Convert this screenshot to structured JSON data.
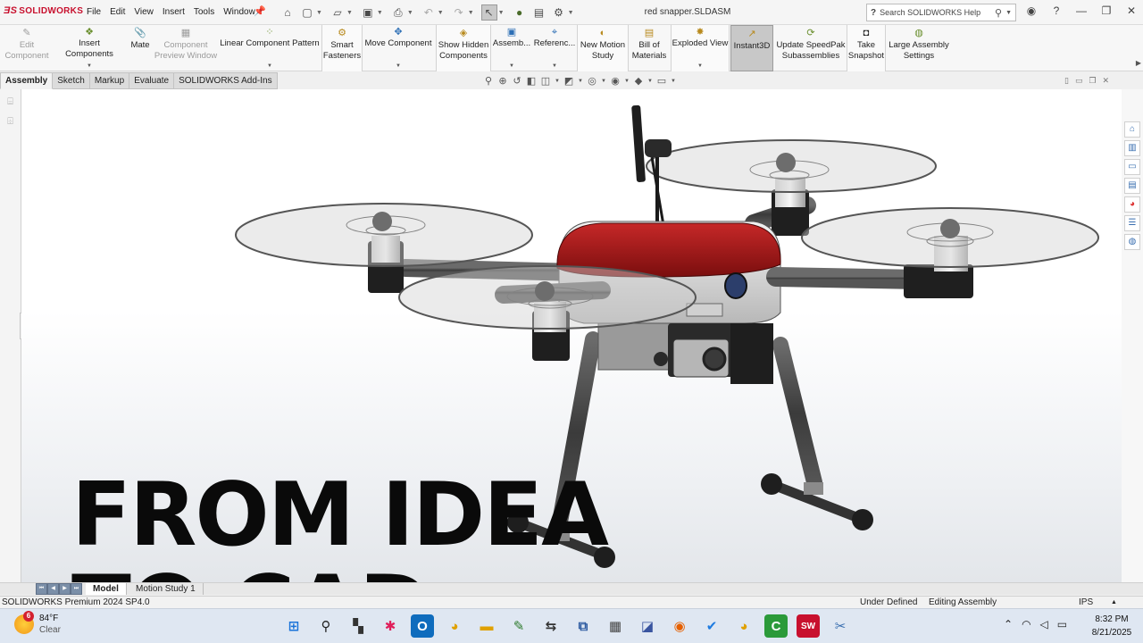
{
  "app": {
    "brand": "SOLIDWORKS",
    "document_title": "red snapper.SLDASM",
    "menus": [
      "File",
      "Edit",
      "View",
      "Insert",
      "Tools",
      "Window"
    ],
    "search_placeholder": "Search SOLIDWORKS Help"
  },
  "commands": [
    {
      "label": "Edit Component",
      "disabled": true,
      "icon": "edit-component-icon"
    },
    {
      "label": "Insert Components",
      "icon": "insert-components-icon"
    },
    {
      "label": "Mate",
      "icon": "mate-icon"
    },
    {
      "label": "Component Preview Window",
      "disabled": true,
      "icon": "preview-window-icon"
    },
    {
      "label": "Linear Component Pattern",
      "icon": "linear-pattern-icon"
    },
    {
      "label": "Smart Fasteners",
      "icon": "smart-fasteners-icon"
    },
    {
      "label": "Move Component",
      "icon": "move-component-icon"
    },
    {
      "label": "Show Hidden Components",
      "icon": "show-hidden-icon"
    },
    {
      "label": "Assemb...",
      "icon": "assembly-features-icon"
    },
    {
      "label": "Referenc...",
      "icon": "reference-geometry-icon"
    },
    {
      "label": "New Motion Study",
      "icon": "motion-study-icon"
    },
    {
      "label": "Bill of Materials",
      "icon": "bom-icon"
    },
    {
      "label": "Exploded View",
      "icon": "exploded-view-icon"
    },
    {
      "label": "Instant3D",
      "icon": "instant3d-icon"
    },
    {
      "label": "Update SpeedPak Subassemblies",
      "icon": "speedpak-icon"
    },
    {
      "label": "Take Snapshot",
      "icon": "snapshot-icon"
    },
    {
      "label": "Large Assembly Settings",
      "icon": "large-assembly-icon"
    }
  ],
  "tabs": [
    "Assembly",
    "Sketch",
    "Markup",
    "Evaluate",
    "SOLIDWORKS Add-Ins"
  ],
  "overlay": {
    "line1": "FROM IDEA",
    "line2": "TO CAD"
  },
  "bottom_tabs": [
    "Model",
    "Motion Study 1"
  ],
  "status": {
    "version": "SOLIDWORKS Premium 2024 SP4.0",
    "defined": "Under Defined",
    "mode": "Editing Assembly",
    "units": "IPS"
  },
  "taskbar": {
    "weather_badge": "6",
    "temperature": "84°F",
    "condition": "Clear",
    "time": "8:32 PM",
    "date": "8/21/2025"
  },
  "colors": {
    "accent": "#c8102e",
    "drone_body": "#a31515",
    "arm": "#4a4a4a"
  }
}
